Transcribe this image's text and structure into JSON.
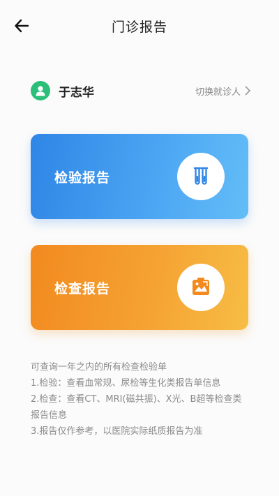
{
  "header": {
    "title": "门诊报告"
  },
  "patient": {
    "name": "于志华",
    "switch_label": "切换就诊人"
  },
  "cards": {
    "lab": {
      "label": "检验报告",
      "icon": "test-tubes-icon",
      "color": "#3d95ee"
    },
    "exam": {
      "label": "检查报告",
      "icon": "scan-image-icon",
      "color": "#f49a2b"
    }
  },
  "notes": [
    "可查询一年之内的所有检查检验单",
    "1.检验：查看血常规、尿检等生化类报告单信息",
    "2.检查：查看CT、MRI(磁共振)、X光、B超等检查类",
    "报告信息",
    "3.报告仅作参考，以医院实际纸质报告为准"
  ]
}
